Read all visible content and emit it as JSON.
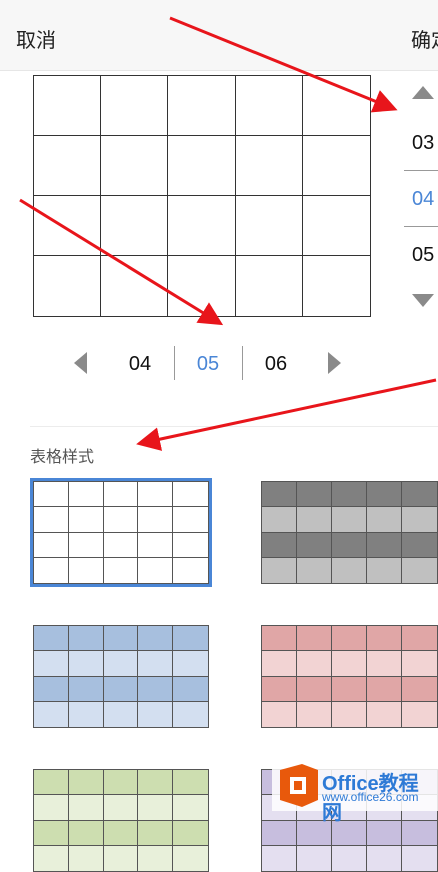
{
  "header": {
    "cancel_label": "取消",
    "confirm_label": "确定"
  },
  "row_picker": {
    "above": "03",
    "selected": "04",
    "below": "05"
  },
  "column_picker": {
    "left": "04",
    "selected": "05",
    "right": "06"
  },
  "section": {
    "table_style_label": "表格样式"
  },
  "styles": [
    {
      "id": "plain",
      "selected": true,
      "header_color": "#ffffff",
      "band_color": "#ffffff"
    },
    {
      "id": "gray",
      "selected": false,
      "header_color": "#808080",
      "band_color": "#c0c0c0"
    },
    {
      "id": "blue",
      "selected": false,
      "header_color": "#a7bfde",
      "band_color": "#d3dff0"
    },
    {
      "id": "red",
      "selected": false,
      "header_color": "#e0a6a6",
      "band_color": "#f2d3d3"
    },
    {
      "id": "green",
      "selected": false,
      "header_color": "#cddeb0",
      "band_color": "#e8f0da"
    },
    {
      "id": "purple",
      "selected": false,
      "header_color": "#c7bede",
      "band_color": "#e4dff0"
    }
  ],
  "colors": {
    "accent": "#4a86d6",
    "arrow": "#e8151b"
  },
  "watermark": {
    "line1": "Office教程网",
    "line2": "www.office26.com"
  }
}
